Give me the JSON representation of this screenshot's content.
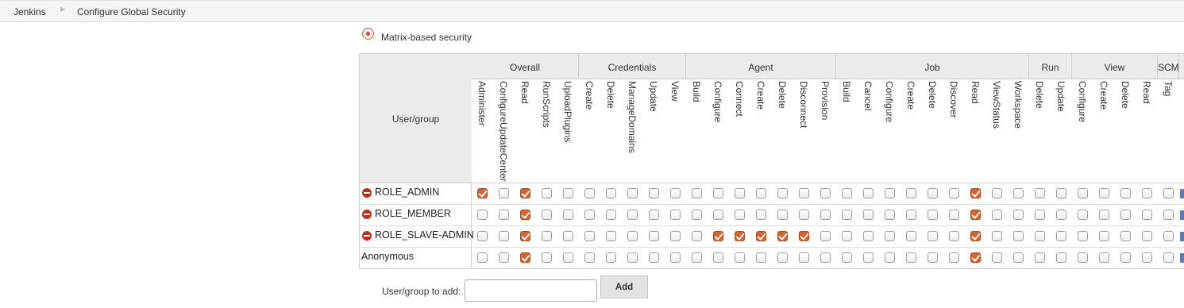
{
  "breadcrumb": {
    "items": [
      "Jenkins",
      "Configure Global Security"
    ]
  },
  "security": {
    "radio_label": "Matrix-based security",
    "selected": true
  },
  "matrix": {
    "user_group_header": "User/group",
    "groups": [
      {
        "name": "Overall",
        "perms": [
          "Administer",
          "ConfigureUpdateCenter",
          "Read",
          "RunScripts",
          "UploadPlugins"
        ]
      },
      {
        "name": "Credentials",
        "perms": [
          "Create",
          "Delete",
          "ManageDomains",
          "Update",
          "View"
        ]
      },
      {
        "name": "Agent",
        "perms": [
          "Build",
          "Configure",
          "Connect",
          "Create",
          "Delete",
          "Disconnect",
          "Provision"
        ]
      },
      {
        "name": "Job",
        "perms": [
          "Build",
          "Cancel",
          "Configure",
          "Create",
          "Delete",
          "Discover",
          "Read",
          "ViewStatus",
          "Workspace"
        ]
      },
      {
        "name": "Run",
        "perms": [
          "Delete",
          "Update"
        ]
      },
      {
        "name": "View",
        "perms": [
          "Configure",
          "Create",
          "Delete",
          "Read"
        ]
      },
      {
        "name": "SCM",
        "perms": [
          "Tag"
        ]
      }
    ],
    "rows": [
      {
        "name": "ROLE_ADMIN",
        "removable": true,
        "checked": [
          0,
          2,
          23
        ]
      },
      {
        "name": "ROLE_MEMBER",
        "removable": true,
        "checked": [
          2,
          23
        ]
      },
      {
        "name": "ROLE_SLAVE-ADMIN",
        "removable": true,
        "checked": [
          2,
          11,
          12,
          13,
          14,
          15,
          23
        ]
      },
      {
        "name": "Anonymous",
        "removable": false,
        "checked": [
          2,
          23
        ]
      }
    ]
  },
  "add_user": {
    "label": "User/group to add:",
    "value": "",
    "button_label": "Add"
  },
  "colors": {
    "checked_fill": "#d9622b",
    "remove_icon": "#c42b1c",
    "header_bg": "#ebebeb"
  },
  "icons": {
    "remove": "remove-circle-icon",
    "radio": "radio-selected-icon",
    "breadcrumb_separator": "chevron-right-icon"
  }
}
